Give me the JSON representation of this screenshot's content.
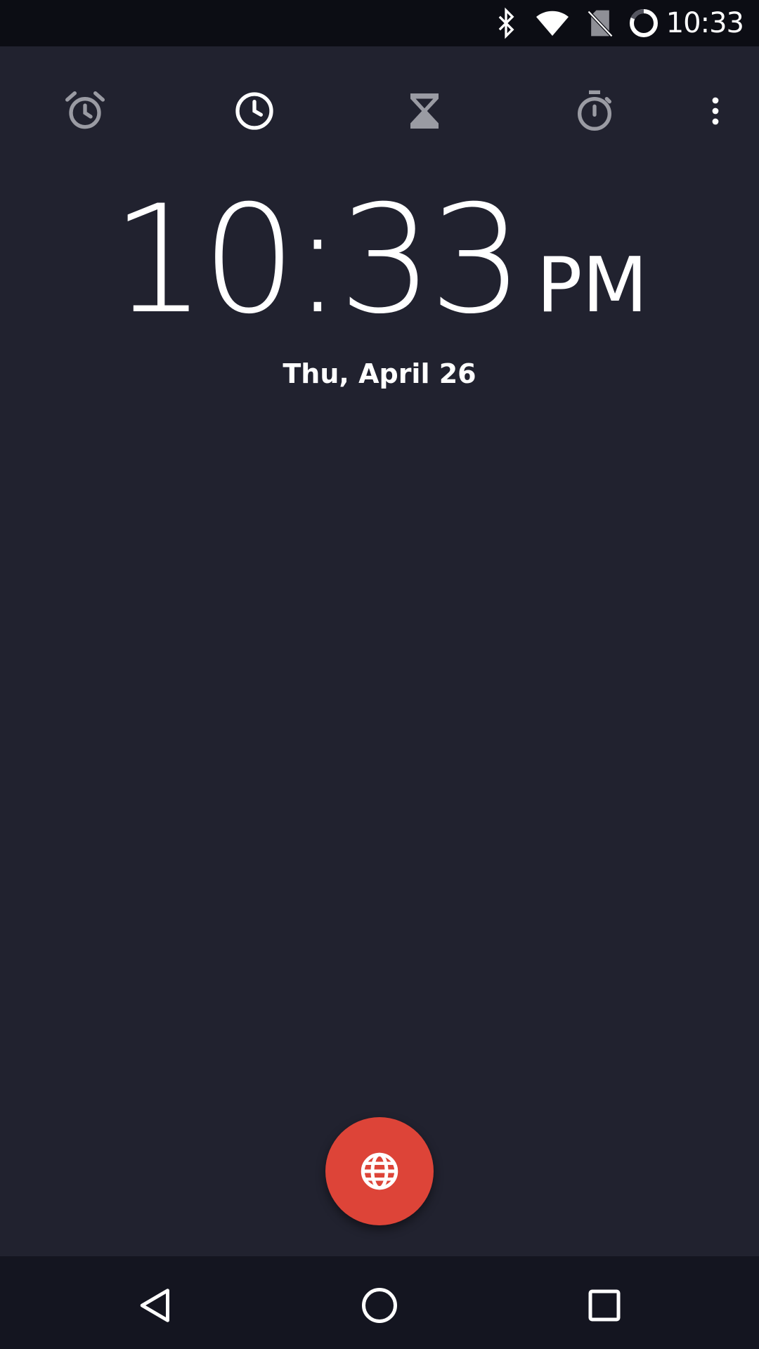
{
  "status_bar": {
    "time": "10:33",
    "icons": [
      "bluetooth-icon",
      "wifi-icon",
      "no-sim-icon",
      "battery-icon"
    ]
  },
  "tabs": [
    {
      "icon": "alarm-icon",
      "active": false
    },
    {
      "icon": "clock-icon",
      "active": true
    },
    {
      "icon": "timer-icon",
      "active": false
    },
    {
      "icon": "stopwatch-icon",
      "active": false
    }
  ],
  "menu_icon": "more-vert-icon",
  "clock": {
    "time": "10:33",
    "ampm": "PM",
    "date": "Thu, April 26"
  },
  "fab": {
    "icon": "globe-icon",
    "color": "#dd4438"
  },
  "nav": [
    "back-icon",
    "home-icon",
    "recents-icon"
  ],
  "colors": {
    "background": "#21222f",
    "status_bar": "#0c0d14",
    "nav_bar": "#141520",
    "active_icon": "#ffffff",
    "inactive_icon": "#9a9ba3"
  }
}
